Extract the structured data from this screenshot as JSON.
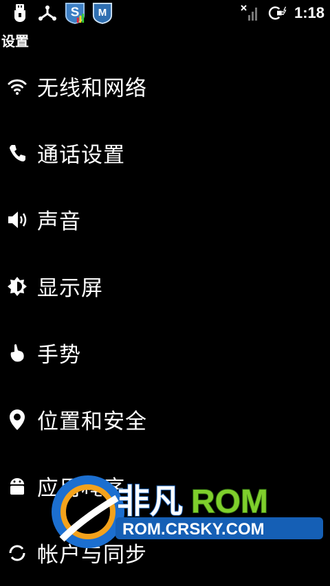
{
  "status_bar": {
    "time": "1:18",
    "left_icons": [
      "usb-icon",
      "usb-debug-icon",
      "security-app-icon",
      "mail-shield-icon"
    ],
    "right_icons": [
      "no-signal-icon",
      "charging-icon"
    ]
  },
  "header": {
    "title": "设置"
  },
  "settings": {
    "items": [
      {
        "label": "无线和网络",
        "icon": "wifi-icon"
      },
      {
        "label": "通话设置",
        "icon": "phone-icon"
      },
      {
        "label": "声音",
        "icon": "speaker-icon"
      },
      {
        "label": "显示屏",
        "icon": "brightness-icon"
      },
      {
        "label": "手势",
        "icon": "gesture-icon"
      },
      {
        "label": "位置和安全",
        "icon": "location-icon"
      },
      {
        "label": "应用程序",
        "icon": "android-icon"
      },
      {
        "label": "帐户与同步",
        "icon": "sync-icon"
      }
    ]
  },
  "watermark": {
    "brand": "非凡ROM",
    "url": "ROM.CRSKY.COM"
  }
}
